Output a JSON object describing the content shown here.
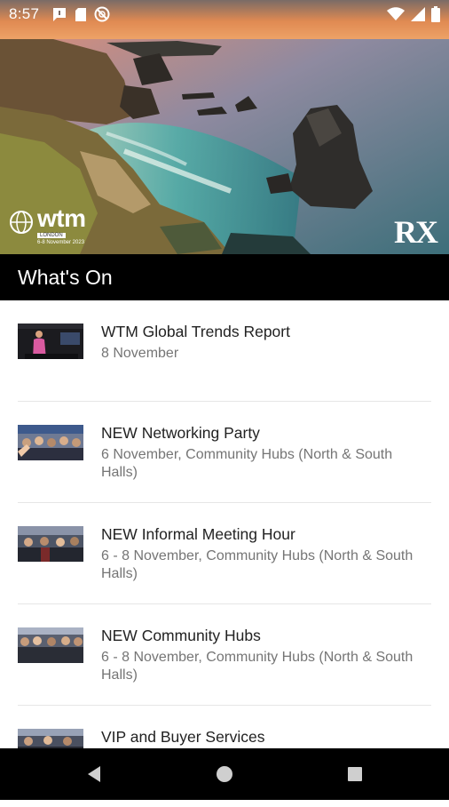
{
  "status_bar": {
    "time": "8:57"
  },
  "hero": {
    "logo_word": "wtm",
    "logo_location": "LONDON",
    "logo_dates": "6-8 November 2023",
    "partner_logo": "RX"
  },
  "section": {
    "title": "What's On"
  },
  "items": [
    {
      "title": "WTM Global Trends Report",
      "subtitle": "8 November"
    },
    {
      "title": "NEW Networking Party",
      "subtitle": "6 November, Community Hubs (North & South Halls)"
    },
    {
      "title": "NEW Informal Meeting Hour",
      "subtitle": "6 - 8 November, Community Hubs (North & South Halls)"
    },
    {
      "title": "NEW Community Hubs",
      "subtitle": "6 - 8 November, Community Hubs (North & South Halls)"
    },
    {
      "title": "VIP and Buyer Services",
      "subtitle": ""
    }
  ],
  "icons": {
    "status": [
      "message-icon",
      "sim-card-icon",
      "do-not-disturb-icon",
      "wifi-icon",
      "signal-icon",
      "battery-icon"
    ],
    "nav": [
      "back-icon",
      "home-icon",
      "recents-icon"
    ]
  }
}
